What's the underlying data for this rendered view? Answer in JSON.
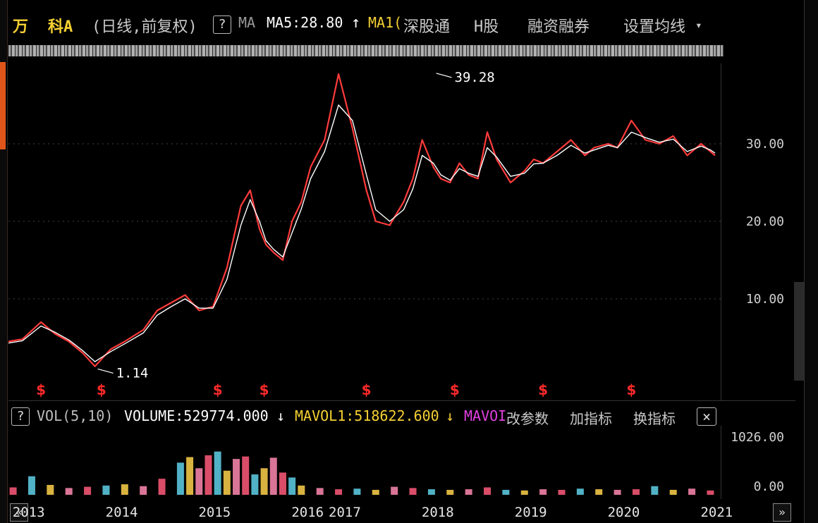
{
  "header": {
    "stock_name_1": "万",
    "stock_name_2": "科A",
    "period": "(日线,前复权)",
    "help_btn": "?",
    "ma_label": "MA",
    "ma5": "MA5:28.80",
    "ma5_arrow": "↑",
    "ma10_partial": "MA1(",
    "tabs": [
      "深股通",
      "H股",
      "融资融券",
      "设置均线"
    ],
    "dropdown_icon": "▾"
  },
  "volume_header": {
    "help_btn": "?",
    "indicator": "VOL(5,10)",
    "volume": "VOLUME:529774.000",
    "volume_arrow": "↓",
    "mavol1": "MAVOL1:518622.600",
    "mavol1_arrow": "↓",
    "mavol2_partial": "MAVOI",
    "actions": [
      "改参数",
      "加指标",
      "换指标"
    ],
    "close": "×"
  },
  "chart_data": [
    {
      "type": "line",
      "title": "",
      "y_ticks": [
        10.0,
        20.0,
        30.0
      ],
      "y_tick_labels": [
        "10.00",
        "20.00",
        "30.00"
      ],
      "ylim": [
        0,
        40
      ],
      "x_labels": [
        "2013",
        "2014",
        "2015",
        "2016",
        "2017",
        "2018",
        "2019",
        "2020",
        "2021"
      ],
      "x_label_pos": [
        2013.0,
        2014.0,
        2015.0,
        2016.0,
        2016.4,
        2017.4,
        2018.4,
        2019.4,
        2020.4
      ],
      "annotations": [
        {
          "label": "39.28",
          "x": 2017.42,
          "y": 39.28
        },
        {
          "label": "1.14",
          "x": 2013.78,
          "y": 1.14
        }
      ],
      "dividend_markers": [
        2013.2,
        2013.85,
        2015.1,
        2015.6,
        2016.7,
        2017.65,
        2018.6,
        2019.55
      ],
      "dividend_symbol": "$",
      "series": [
        {
          "color": "#ff3b3b",
          "x": [
            2012.85,
            2013.0,
            2013.2,
            2013.35,
            2013.5,
            2013.65,
            2013.78,
            2013.95,
            2014.1,
            2014.3,
            2014.45,
            2014.6,
            2014.75,
            2014.9,
            2015.05,
            2015.2,
            2015.35,
            2015.45,
            2015.55,
            2015.62,
            2015.7,
            2015.8,
            2015.9,
            2016.0,
            2016.1,
            2016.25,
            2016.4,
            2016.55,
            2016.7,
            2016.8,
            2016.95,
            2017.1,
            2017.2,
            2017.3,
            2017.42,
            2017.5,
            2017.6,
            2017.7,
            2017.8,
            2017.9,
            2018.0,
            2018.1,
            2018.25,
            2018.4,
            2018.5,
            2018.6,
            2018.75,
            2018.9,
            2019.05,
            2019.15,
            2019.3,
            2019.4,
            2019.55,
            2019.7,
            2019.85,
            2020.0,
            2020.15,
            2020.3,
            2020.4,
            2020.45
          ],
          "values": [
            4.5,
            4.8,
            7.0,
            5.5,
            4.5,
            3.0,
            1.3,
            3.5,
            4.5,
            6.0,
            8.5,
            9.5,
            10.5,
            8.5,
            9.0,
            14.0,
            22.0,
            24.0,
            19.0,
            17.0,
            16.0,
            15.0,
            20.0,
            22.5,
            27.0,
            30.5,
            39.0,
            32.0,
            24.0,
            20.0,
            19.5,
            22.5,
            25.5,
            30.5,
            27.0,
            25.5,
            25.0,
            27.5,
            26.0,
            25.5,
            31.5,
            28.0,
            25.0,
            26.5,
            28.0,
            27.5,
            29.0,
            30.5,
            28.5,
            29.5,
            30.0,
            29.5,
            33.0,
            30.5,
            30.0,
            31.0,
            28.5,
            30.0,
            29.0,
            28.5
          ]
        },
        {
          "color": "#ffffff",
          "x": [
            2012.85,
            2013.0,
            2013.2,
            2013.35,
            2013.5,
            2013.65,
            2013.78,
            2013.95,
            2014.1,
            2014.3,
            2014.45,
            2014.6,
            2014.75,
            2014.9,
            2015.05,
            2015.2,
            2015.35,
            2015.45,
            2015.55,
            2015.62,
            2015.7,
            2015.8,
            2015.9,
            2016.0,
            2016.1,
            2016.25,
            2016.4,
            2016.55,
            2016.7,
            2016.8,
            2016.95,
            2017.1,
            2017.2,
            2017.3,
            2017.42,
            2017.5,
            2017.6,
            2017.7,
            2017.8,
            2017.9,
            2018.0,
            2018.1,
            2018.25,
            2018.4,
            2018.5,
            2018.6,
            2018.75,
            2018.9,
            2019.05,
            2019.15,
            2019.3,
            2019.4,
            2019.55,
            2019.7,
            2019.85,
            2020.0,
            2020.15,
            2020.3,
            2020.4,
            2020.45
          ],
          "values": [
            4.3,
            4.6,
            6.5,
            5.7,
            4.7,
            3.3,
            1.9,
            3.2,
            4.2,
            5.6,
            7.9,
            9.0,
            10.0,
            8.8,
            8.8,
            12.5,
            19.5,
            22.8,
            20.0,
            17.5,
            16.4,
            15.4,
            18.5,
            21.6,
            25.5,
            29.0,
            35.0,
            33.0,
            26.0,
            21.5,
            20.0,
            21.5,
            24.2,
            28.5,
            27.5,
            26.0,
            25.3,
            26.8,
            26.2,
            25.8,
            29.5,
            28.3,
            25.8,
            26.2,
            27.4,
            27.5,
            28.5,
            29.8,
            28.8,
            29.2,
            29.8,
            29.5,
            31.5,
            30.8,
            30.2,
            30.6,
            29.0,
            29.7,
            29.2,
            28.8
          ]
        }
      ]
    },
    {
      "type": "bar",
      "title": "",
      "y_ticks": [
        0.0,
        1026.0
      ],
      "y_tick_labels": [
        "0.00",
        "1026.00"
      ],
      "ylim": [
        0,
        1026
      ],
      "x": [
        2012.9,
        2013.1,
        2013.3,
        2013.5,
        2013.7,
        2013.9,
        2014.1,
        2014.3,
        2014.5,
        2014.7,
        2014.8,
        2014.9,
        2015.0,
        2015.1,
        2015.2,
        2015.3,
        2015.4,
        2015.5,
        2015.6,
        2015.7,
        2015.8,
        2015.9,
        2016.0,
        2016.2,
        2016.4,
        2016.6,
        2016.8,
        2017.0,
        2017.2,
        2017.4,
        2017.6,
        2017.8,
        2018.0,
        2018.2,
        2018.4,
        2018.6,
        2018.8,
        2019.0,
        2019.2,
        2019.4,
        2019.6,
        2019.8,
        2020.0,
        2020.2,
        2020.4
      ],
      "values": [
        120,
        300,
        160,
        110,
        130,
        150,
        170,
        140,
        260,
        520,
        610,
        430,
        640,
        700,
        390,
        580,
        620,
        330,
        430,
        600,
        360,
        280,
        150,
        110,
        90,
        100,
        80,
        130,
        110,
        90,
        80,
        90,
        120,
        80,
        70,
        90,
        80,
        100,
        90,
        80,
        90,
        140,
        80,
        100,
        70
      ]
    }
  ]
}
